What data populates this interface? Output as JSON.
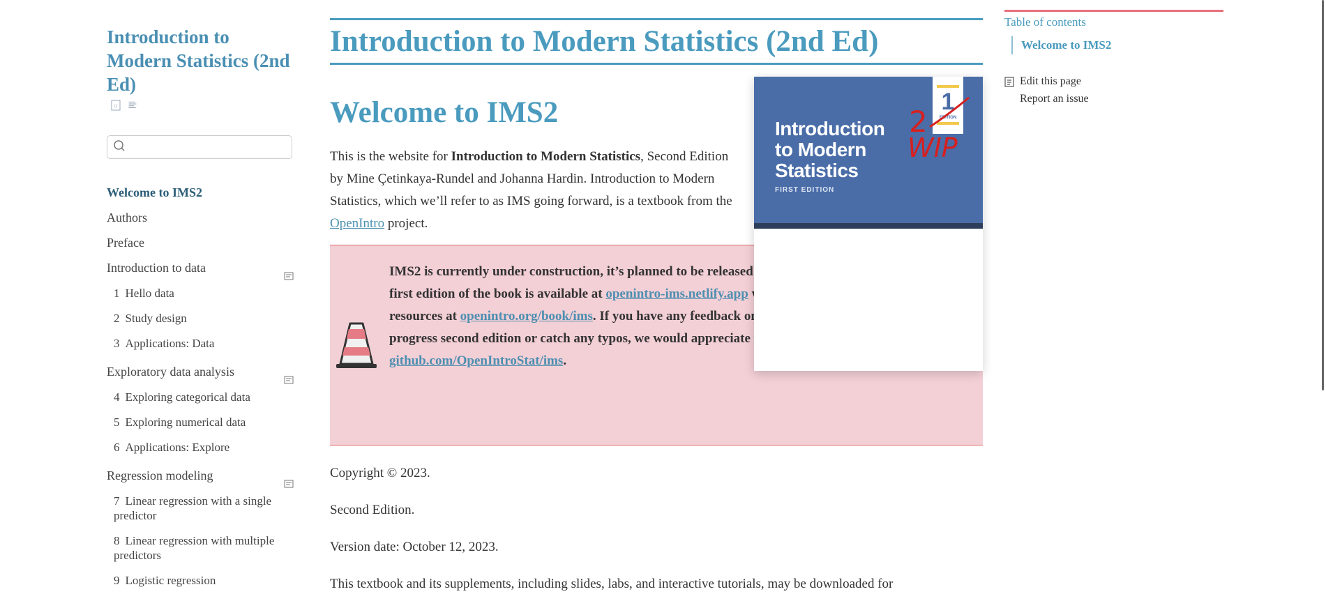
{
  "sidebar": {
    "title": "Introduction to Modern Statistics (2nd Ed)",
    "search": {
      "placeholder": "",
      "value": ""
    },
    "nav": [
      {
        "type": "item",
        "label": "Welcome to IMS2",
        "active": true
      },
      {
        "type": "item",
        "label": "Authors"
      },
      {
        "type": "item",
        "label": "Preface"
      },
      {
        "type": "part",
        "label": "Introduction to data"
      },
      {
        "type": "chapter",
        "num": "1",
        "label": "Hello data"
      },
      {
        "type": "chapter",
        "num": "2",
        "label": "Study design"
      },
      {
        "type": "chapter",
        "num": "3",
        "label": "Applications: Data"
      },
      {
        "type": "part",
        "label": "Exploratory data analysis"
      },
      {
        "type": "chapter",
        "num": "4",
        "label": "Exploring categorical data"
      },
      {
        "type": "chapter",
        "num": "5",
        "label": "Exploring numerical data"
      },
      {
        "type": "chapter",
        "num": "6",
        "label": "Applications: Explore"
      },
      {
        "type": "part",
        "label": "Regression modeling"
      },
      {
        "type": "chapter",
        "num": "7",
        "label": "Linear regression with a single predictor"
      },
      {
        "type": "chapter",
        "num": "8",
        "label": "Linear regression with multiple predictors"
      },
      {
        "type": "chapter",
        "num": "9",
        "label": "Logistic regression"
      }
    ]
  },
  "main": {
    "book_title": "Introduction to Modern Statistics (2nd Ed)",
    "heading": "Welcome to IMS2",
    "intro": {
      "pre": "This is the website for ",
      "bold": "Introduction to Modern Statistics",
      "mid": ", Second Edition by Mine Çetinkaya-Rundel and Johanna Hardin. Introduction to Modern Statistics, which we’ll refer to as IMS going forward, is a textbook from the ",
      "link": "OpenIntro",
      "post": " project."
    },
    "cover": {
      "title_line1": "Introduction",
      "title_line2": "to Modern",
      "title_line3": "Statistics",
      "subtitle": "FIRST EDITION",
      "badge_number": "1",
      "badge_label": "EDITION",
      "annotation_number": "2",
      "annotation_text": "WIP"
    },
    "callout": {
      "t1": "IMS2 is currently under construction, it’s planned to be released in Spring 2024. The first edition of the book is available at ",
      "link1": "openintro-ims.netlify.app",
      "t2": " with additional resources at ",
      "link2": "openintro.org/book/ims",
      "t3": ". If you have any feedback on the work-in-progress second edition or catch any typos, we would appreciate you reporting at ",
      "link3": "github.com/OpenIntroStat/ims",
      "t4": "."
    },
    "copyright": "Copyright © 2023.",
    "edition": "Second Edition.",
    "version": "Version date: October 12, 2023.",
    "supplements": "This textbook and its supplements, including slides, labs, and interactive tutorials, may be downloaded for"
  },
  "toc": {
    "title": "Table of contents",
    "entry": "Welcome to IMS2",
    "edit": "Edit this page",
    "report": "Report an issue"
  },
  "colors": {
    "accent": "#4a9bbe",
    "callout_bg": "#f3cfd6",
    "callout_border": "#e06a6a",
    "toc_bar": "#e9707a"
  }
}
